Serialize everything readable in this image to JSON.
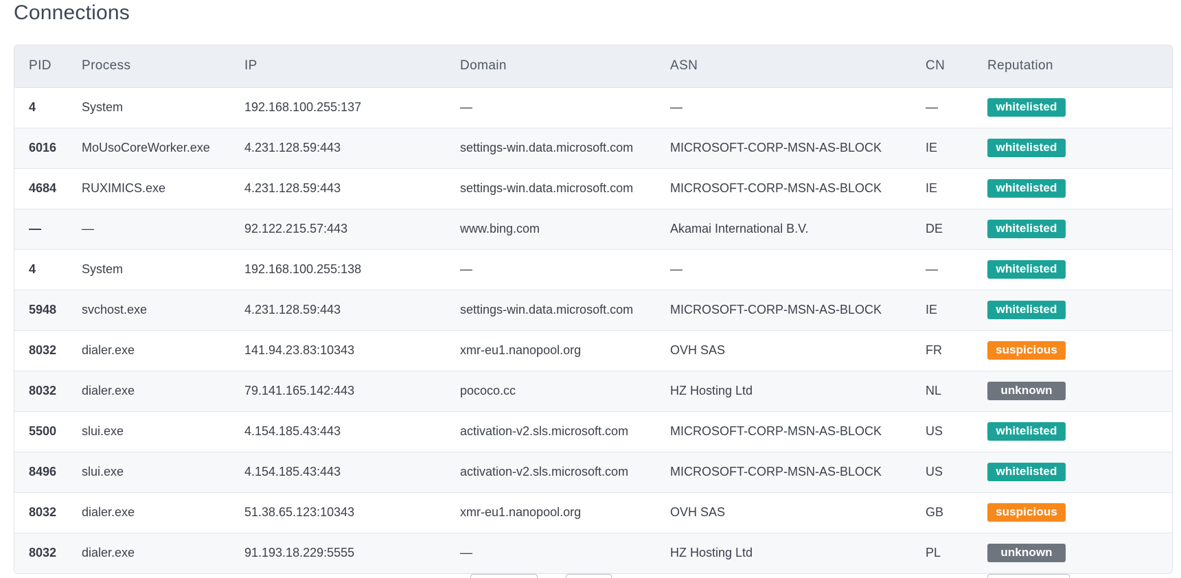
{
  "page": {
    "title": "Connections"
  },
  "colors": {
    "whitelisted": "#1ca399",
    "suspicious": "#f7891c",
    "unknown": "#6e757f",
    "header_bg": "#eceff3"
  },
  "table": {
    "columns": [
      "PID",
      "Process",
      "IP",
      "Domain",
      "ASN",
      "CN",
      "Reputation"
    ],
    "rows": [
      {
        "pid": "4",
        "process": "System",
        "ip": "192.168.100.255:137",
        "domain": "—",
        "asn": "—",
        "cn": "—",
        "reputation": "whitelisted"
      },
      {
        "pid": "6016",
        "process": "MoUsoCoreWorker.exe",
        "ip": "4.231.128.59:443",
        "domain": "settings-win.data.microsoft.com",
        "asn": "MICROSOFT-CORP-MSN-AS-BLOCK",
        "cn": "IE",
        "reputation": "whitelisted"
      },
      {
        "pid": "4684",
        "process": "RUXIMICS.exe",
        "ip": "4.231.128.59:443",
        "domain": "settings-win.data.microsoft.com",
        "asn": "MICROSOFT-CORP-MSN-AS-BLOCK",
        "cn": "IE",
        "reputation": "whitelisted"
      },
      {
        "pid": "—",
        "process": "—",
        "ip": "92.122.215.57:443",
        "domain": "www.bing.com",
        "asn": "Akamai International B.V.",
        "cn": "DE",
        "reputation": "whitelisted"
      },
      {
        "pid": "4",
        "process": "System",
        "ip": "192.168.100.255:138",
        "domain": "—",
        "asn": "—",
        "cn": "—",
        "reputation": "whitelisted"
      },
      {
        "pid": "5948",
        "process": "svchost.exe",
        "ip": "4.231.128.59:443",
        "domain": "settings-win.data.microsoft.com",
        "asn": "MICROSOFT-CORP-MSN-AS-BLOCK",
        "cn": "IE",
        "reputation": "whitelisted"
      },
      {
        "pid": "8032",
        "process": "dialer.exe",
        "ip": "141.94.23.83:10343",
        "domain": "xmr-eu1.nanopool.org",
        "asn": "OVH SAS",
        "cn": "FR",
        "reputation": "suspicious"
      },
      {
        "pid": "8032",
        "process": "dialer.exe",
        "ip": "79.141.165.142:443",
        "domain": "pococo.cc",
        "asn": "HZ Hosting Ltd",
        "cn": "NL",
        "reputation": "unknown"
      },
      {
        "pid": "5500",
        "process": "slui.exe",
        "ip": "4.154.185.43:443",
        "domain": "activation-v2.sls.microsoft.com",
        "asn": "MICROSOFT-CORP-MSN-AS-BLOCK",
        "cn": "US",
        "reputation": "whitelisted"
      },
      {
        "pid": "8496",
        "process": "slui.exe",
        "ip": "4.154.185.43:443",
        "domain": "activation-v2.sls.microsoft.com",
        "asn": "MICROSOFT-CORP-MSN-AS-BLOCK",
        "cn": "US",
        "reputation": "whitelisted"
      },
      {
        "pid": "8032",
        "process": "dialer.exe",
        "ip": "51.38.65.123:10343",
        "domain": "xmr-eu1.nanopool.org",
        "asn": "OVH SAS",
        "cn": "GB",
        "reputation": "suspicious"
      },
      {
        "pid": "8032",
        "process": "dialer.exe",
        "ip": "91.193.18.229:5555",
        "domain": "—",
        "asn": "HZ Hosting Ltd",
        "cn": "PL",
        "reputation": "unknown"
      }
    ]
  }
}
